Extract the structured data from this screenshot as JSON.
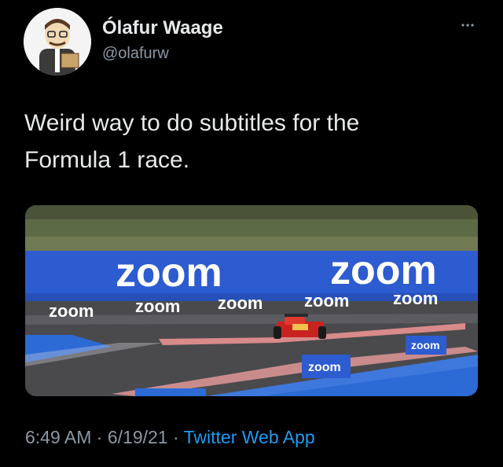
{
  "author": {
    "name": "Ólafur Waage",
    "handle": "@olafurw",
    "avatar_icon": "avatar-cartoon-icon"
  },
  "menu": {
    "icon": "more-options-icon"
  },
  "tweet": {
    "text_lines": [
      "Weird way to do subtitles for the",
      "Formula 1 race."
    ]
  },
  "media": {
    "logo_big": "zoom",
    "logo_small": "zoom",
    "icon": "race-photo-icon"
  },
  "footer": {
    "time": "6:49 AM",
    "sep1": " · ",
    "date": "6/19/21",
    "sep2": " · ",
    "source": "Twitter Web App"
  },
  "colors": {
    "background": "#000000",
    "text": "#e7e9ea",
    "muted": "#8b98a5",
    "link": "#1d9bf0",
    "zoom_blue": "#2d5bd0"
  }
}
